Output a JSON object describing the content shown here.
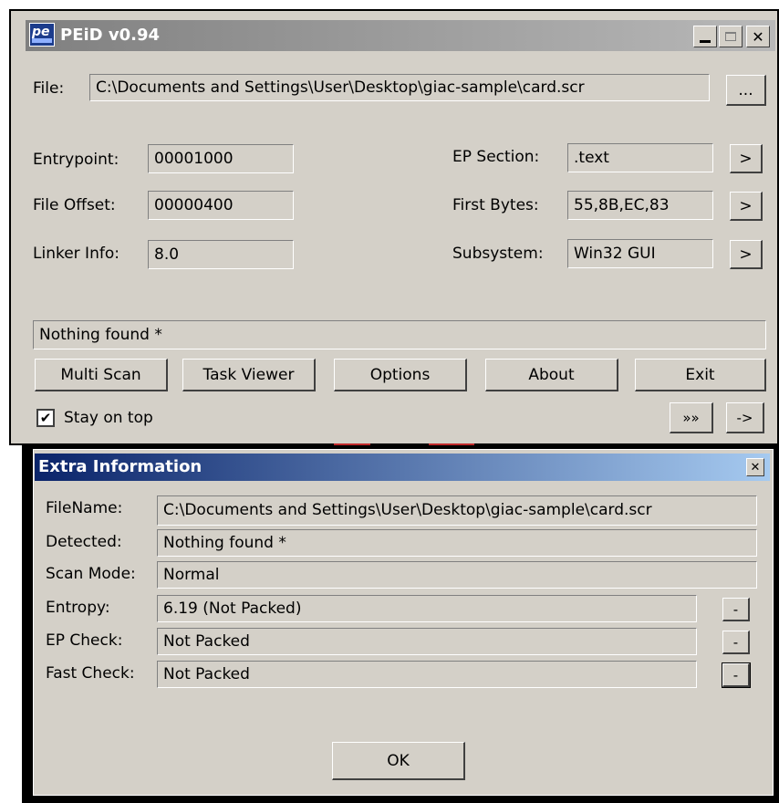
{
  "main_window": {
    "title": "PEiD v0.94",
    "logo_text": "pe",
    "file_label": "File:",
    "file_path": "C:\\Documents and Settings\\User\\Desktop\\giac-sample\\card.scr",
    "browse_label": "...",
    "entrypoint_label": "Entrypoint:",
    "entrypoint_value": "00001000",
    "file_offset_label": "File Offset:",
    "file_offset_value": "00000400",
    "linker_info_label": "Linker Info:",
    "linker_info_value": "8.0",
    "ep_section_label": "EP Section:",
    "ep_section_value": ".text",
    "first_bytes_label": "First Bytes:",
    "first_bytes_value": "55,8B,EC,83",
    "subsystem_label": "Subsystem:",
    "subsystem_value": "Win32 GUI",
    "arrow_label": ">",
    "result": "Nothing found *",
    "buttons": {
      "multi_scan": "Multi Scan",
      "task_viewer": "Task Viewer",
      "options": "Options",
      "about": "About",
      "exit": "Exit"
    },
    "stay_on_top_label": "Stay on top",
    "stay_on_top_checked": true,
    "extra_button": "»»",
    "ext_button": "->"
  },
  "extra_window": {
    "title": "Extra Information",
    "filename_label": "FileName:",
    "filename_value": "C:\\Documents and Settings\\User\\Desktop\\giac-sample\\card.scr",
    "detected_label": "Detected:",
    "detected_value": "Nothing found *",
    "scan_mode_label": "Scan Mode:",
    "scan_mode_value": "Normal",
    "entropy_label": "Entropy:",
    "entropy_value": "6.19 (Not Packed)",
    "ep_check_label": "EP Check:",
    "ep_check_value": "Not Packed",
    "fast_check_label": "Fast Check:",
    "fast_check_value": "Not Packed",
    "small_button": "-",
    "ok_label": "OK"
  },
  "colors": {
    "window_face": "#d4d0c8",
    "active_title_start": "#0a246a",
    "active_title_end": "#a6caf0",
    "inactive_title_start": "#808080"
  }
}
